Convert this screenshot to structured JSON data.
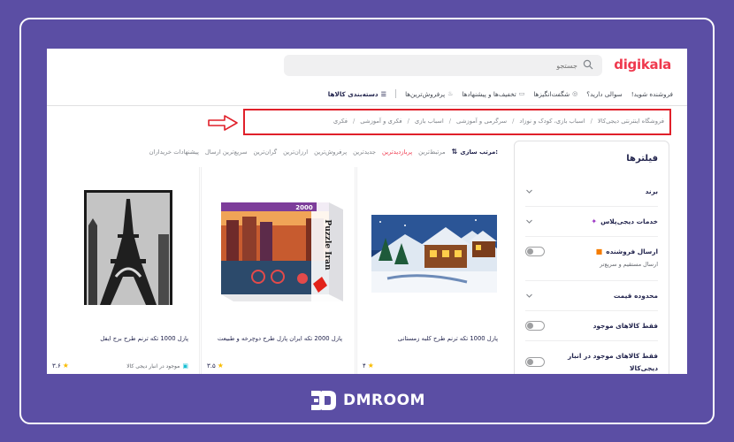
{
  "header": {
    "logo": "digikala",
    "search_placeholder": "جستجو"
  },
  "nav": {
    "categories": "دسته‌بندی کالاها",
    "items": [
      "پرفروش‌ترین‌ها",
      "تخفیف‌ها و پیشنهادها",
      "شگفت‌انگیزها",
      "سوالی دارید؟",
      "فروشنده شوید!"
    ]
  },
  "breadcrumb": [
    "فروشگاه اینترنتی دیجی‌کالا",
    "اسباب بازی، کودک و نوزاد",
    "سرگرمی و آموزشی",
    "اسباب بازی",
    "فکری و آموزشی",
    "فکری"
  ],
  "sort": {
    "title": "مرتب سازی:",
    "options": [
      "مرتبط‌ترین",
      "پربازدیدترین",
      "جدیدترین",
      "پرفروش‌ترین",
      "ارزان‌ترین",
      "گران‌ترین",
      "سریع‌ترین ارسال",
      "پیشنهادات خریداران"
    ],
    "active_index": 1
  },
  "filters": {
    "title": "فیلترها",
    "brand": "برند",
    "digiplus": "خدمات دیجی‌پلاس",
    "seller_shipping": "ارسال فروشنده",
    "seller_shipping_sub": "ارسال مستقیم و سریع‌تر",
    "price_range": "محدوده قیمت",
    "only_available": "فقط کالاهای موجود",
    "only_warehouse": "فقط کالاهای موجود در انبار",
    "only_warehouse_2": "دیجی‌کالا"
  },
  "products": [
    {
      "name": "پازل 1000 تکه ترنم طرح کلبه زمستانی",
      "rating": "۴",
      "stock": ""
    },
    {
      "name": "پازل 2000 تکه ایران پازل طرح دوچرخه و طبیعت",
      "rating": "۳.۵",
      "stock": "",
      "box_label": "Puzzle Iran",
      "box_count": "2000"
    },
    {
      "name": "پازل 1000 تکه ترنم طرح برج ایفل",
      "rating": "۳.۶",
      "stock": "موجود در انبار دیجی کالا"
    }
  ],
  "footer": {
    "brand": "DMROOM"
  },
  "colors": {
    "background": "#5b4ea4",
    "accent": "#ef394e",
    "highlight": "#e0202a"
  }
}
